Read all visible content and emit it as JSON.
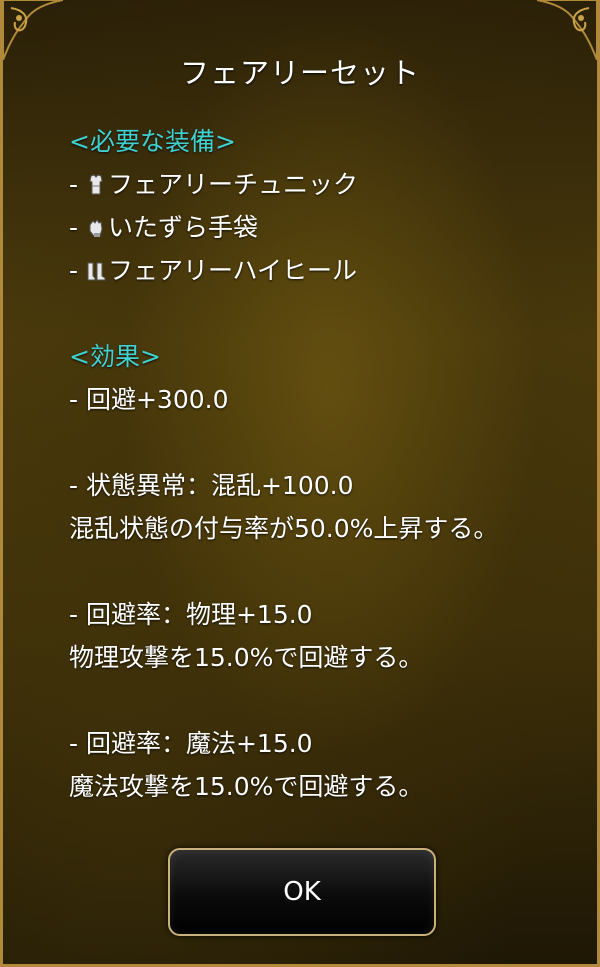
{
  "dialog": {
    "title": "フェアリーセット",
    "required_heading": "<必要な装備>",
    "equipment": [
      {
        "prefix": "- ",
        "icon": "tunic-icon",
        "name": "フェアリーチュニック"
      },
      {
        "prefix": "- ",
        "icon": "glove-icon",
        "name": "いたずら手袋"
      },
      {
        "prefix": "- ",
        "icon": "boots-icon",
        "name": "フェアリーハイヒール"
      }
    ],
    "effect_heading": "<効果>",
    "effects": [
      {
        "line": "-  回避+300.0"
      },
      {
        "line": "-  状態異常：混乱+100.0",
        "desc": "混乱状態の付与率が50.0%上昇する。"
      },
      {
        "line": "-  回避率：物理+15.0",
        "desc": "物理攻撃を15.0%で回避する。"
      },
      {
        "line": "-  回避率：魔法+15.0",
        "desc": "魔法攻撃を15.0%で回避する。"
      }
    ],
    "ok_label": "OK"
  },
  "colors": {
    "heading": "#3fd0d0",
    "text": "#ffffff",
    "border": "#b08a3a"
  }
}
